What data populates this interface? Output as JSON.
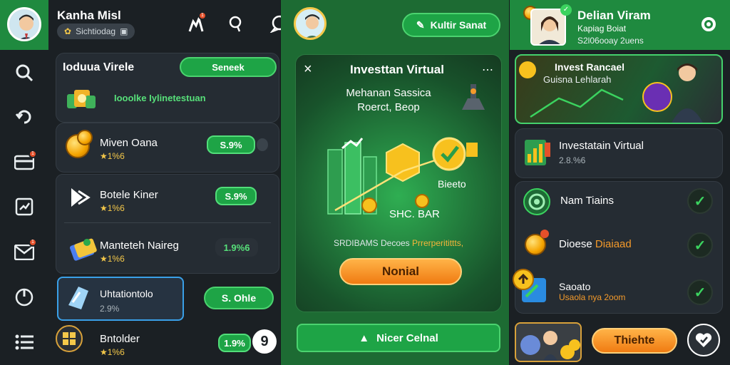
{
  "left_nav": {
    "icons": [
      "search-icon",
      "refresh-icon",
      "card-icon",
      "chart-icon",
      "mail-icon",
      "power-icon",
      "menu-icon"
    ],
    "badge": "1"
  },
  "panel1": {
    "user_name": "Kanha Misl",
    "user_badge": "Sichtiodag",
    "header_icons": [
      "invest-icon",
      "search-icon",
      "chat-icon"
    ],
    "header_badge": "1",
    "section": {
      "title": "Ioduua Virele",
      "button": "Seneek",
      "note": "Iooolke Iylinetestuan"
    },
    "rows": [
      {
        "title": "Miven Oana",
        "sub": "★1%6",
        "pct": "S.9%"
      },
      {
        "title": "Botele Kiner",
        "sub": "★1%6",
        "pct": "S.9%"
      },
      {
        "title": "Manteteh Naireg",
        "sub": "★1%6",
        "pct": "1.9%6"
      },
      {
        "title": "Uhtationtolo",
        "sub": "2.9%",
        "btn": "S. Ohle"
      },
      {
        "title": "Bntolder",
        "sub": "★1%6",
        "pct": "1.9%",
        "num": "9"
      }
    ]
  },
  "panel2": {
    "top_button": "Kultir Sanat",
    "modal": {
      "title": "Investtan Virtual",
      "close": "×",
      "menu": "⋯",
      "subtitle_1": "Mehanan Sassica",
      "subtitle_2": "Roerct, Beop",
      "label_right": "Bieeto",
      "label_coins": "SHC. BAR",
      "note_prefix": "SRDIBAMS Decoes ",
      "note_highlight": "Prrerperitittts,",
      "button": "Nonial"
    },
    "bottom_button": "Nicer Celnal"
  },
  "panel3": {
    "user_name": "Delian Viram",
    "user_line2": "Kapiag Boiat",
    "user_line3": "S2l06ooay 2uens",
    "banner": {
      "title": "Invest Rancael",
      "subtitle": "Guisna Lehlarah"
    },
    "card_title": "Investatain Virtual",
    "card_sub": "2.8.%6",
    "items": [
      {
        "title": "Nam Tiains",
        "highlight": "",
        "check": "✓"
      },
      {
        "title": "Dioese ",
        "highlight": "Diaiaad",
        "check": "✓"
      },
      {
        "title": "Saoato",
        "highlight": "Usaola nya 2oom",
        "check": "✓"
      }
    ],
    "bottom_button": "Thiehte",
    "colors": {
      "accent": "#1ea446",
      "orange": "#f49a2a",
      "badge": "#e5502a"
    }
  }
}
